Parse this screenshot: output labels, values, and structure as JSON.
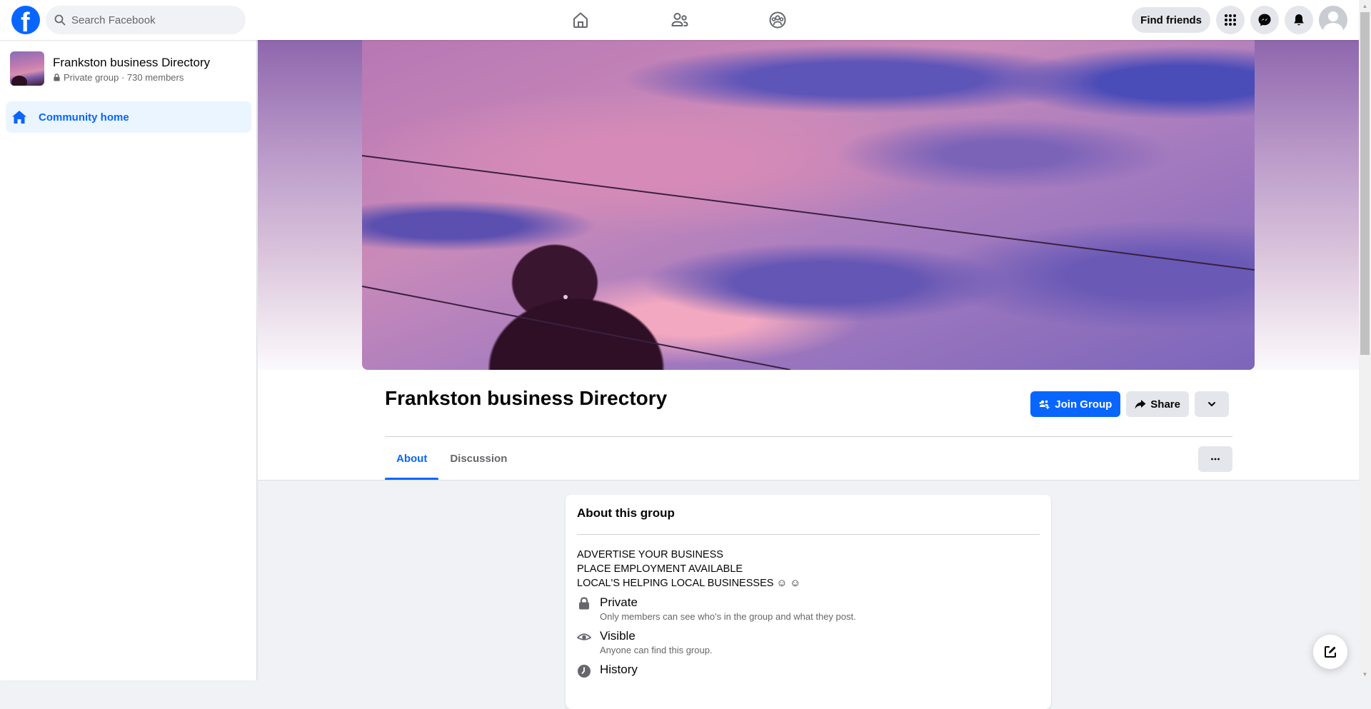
{
  "topbar": {
    "search_placeholder": "Search Facebook",
    "nav_icons": [
      "home-icon",
      "friends-icon",
      "groups-icon"
    ],
    "find_friends_label": "Find friends",
    "right_icons": [
      "menu-grid-icon",
      "messenger-icon",
      "notifications-bell-icon",
      "profile-avatar"
    ]
  },
  "sidebar": {
    "group_name": "Frankston business Directory",
    "group_privacy": "Private group",
    "group_separator": " · ",
    "group_members": "730 members",
    "items": [
      {
        "label": "Community home",
        "icon": "home-icon",
        "active": true
      }
    ]
  },
  "header": {
    "group_title": "Frankston business Directory",
    "join_label": "Join Group",
    "share_label": "Share",
    "tabs": [
      {
        "label": "About",
        "active": true
      },
      {
        "label": "Discussion",
        "active": false
      }
    ]
  },
  "about": {
    "title": "About this group",
    "description": [
      "ADVERTISE YOUR BUSINESS",
      "PLACE EMPLOYMENT AVAILABLE",
      "LOCAL'S HELPING LOCAL BUSINESSES ☺ ☺"
    ],
    "info": [
      {
        "icon": "lock-icon",
        "title": "Private",
        "subtitle": "Only members can see who's in the group and what they post."
      },
      {
        "icon": "eye-icon",
        "title": "Visible",
        "subtitle": "Anyone can find this group."
      },
      {
        "icon": "clock-icon",
        "title": "History",
        "subtitle": ""
      }
    ]
  },
  "colors": {
    "brand": "#0866ff",
    "active_bg": "#ebf5ff",
    "secondary_btn": "#e4e6eb",
    "page_bg": "#f0f2f5"
  }
}
